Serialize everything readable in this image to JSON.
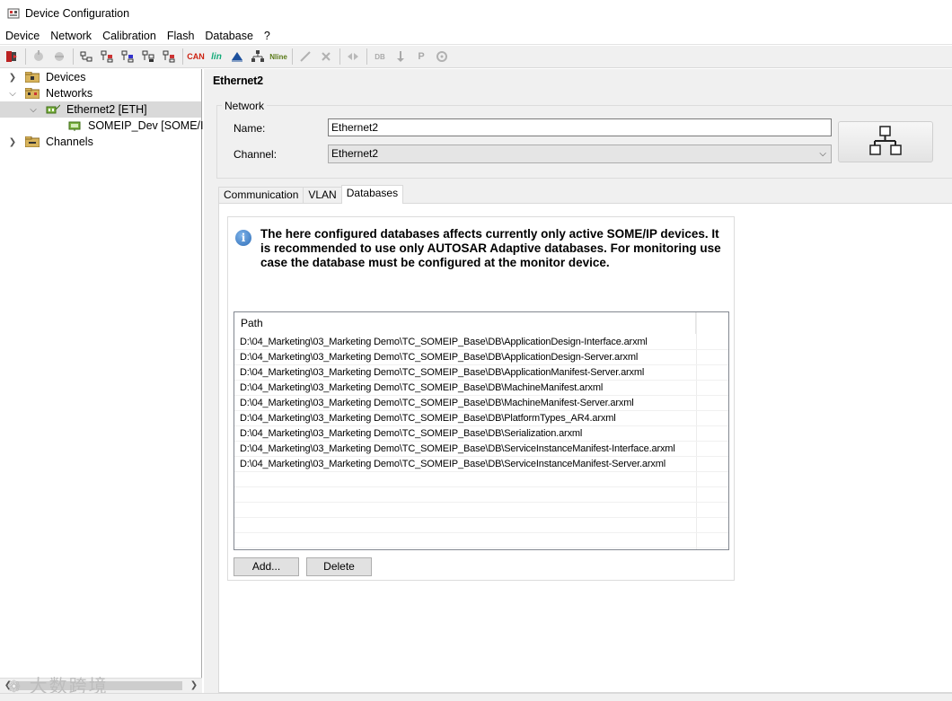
{
  "window": {
    "title": "Device Configuration"
  },
  "menu": [
    "Device",
    "Network",
    "Calibration",
    "Flash",
    "Database",
    "?"
  ],
  "toolbar": {
    "can_label": "CAN",
    "lin_label": "lin",
    "nline_label": "Nline",
    "db_label": "DB",
    "p_label": "P"
  },
  "tree": {
    "devices": "Devices",
    "networks": "Networks",
    "ethernet": "Ethernet2 [ETH]",
    "someip": "SOMEIP_Dev [SOME/IP]",
    "channels": "Channels"
  },
  "content": {
    "heading": "Ethernet2",
    "group_title": "Network",
    "name_label": "Name:",
    "name_value": "Ethernet2",
    "channel_label": "Channel:",
    "channel_value": "Ethernet2"
  },
  "tabs": [
    "Communication",
    "VLAN",
    "Databases"
  ],
  "active_tab": "Databases",
  "databases": {
    "info": "The here configured databases affects currently only active SOME/IP devices. It is recommended to use only AUTOSAR Adaptive databases. For monitoring use case the database must be configured at the monitor device.",
    "column_header": "Path",
    "paths": [
      "D:\\04_Marketing\\03_Marketing Demo\\TC_SOMEIP_Base\\DB\\ApplicationDesign-Interface.arxml",
      "D:\\04_Marketing\\03_Marketing Demo\\TC_SOMEIP_Base\\DB\\ApplicationDesign-Server.arxml",
      "D:\\04_Marketing\\03_Marketing Demo\\TC_SOMEIP_Base\\DB\\ApplicationManifest-Server.arxml",
      "D:\\04_Marketing\\03_Marketing Demo\\TC_SOMEIP_Base\\DB\\MachineManifest.arxml",
      "D:\\04_Marketing\\03_Marketing Demo\\TC_SOMEIP_Base\\DB\\MachineManifest-Server.arxml",
      "D:\\04_Marketing\\03_Marketing Demo\\TC_SOMEIP_Base\\DB\\PlatformTypes_AR4.arxml",
      "D:\\04_Marketing\\03_Marketing Demo\\TC_SOMEIP_Base\\DB\\Serialization.arxml",
      "D:\\04_Marketing\\03_Marketing Demo\\TC_SOMEIP_Base\\DB\\ServiceInstanceManifest-Interface.arxml",
      "D:\\04_Marketing\\03_Marketing Demo\\TC_SOMEIP_Base\\DB\\ServiceInstanceManifest-Server.arxml"
    ],
    "add_label": "Add...",
    "delete_label": "Delete"
  },
  "watermark": "大数跨境",
  "colors": {
    "selection": "#d9d9d9",
    "panel": "#f0f0f0",
    "info": "#2f6eb8"
  }
}
